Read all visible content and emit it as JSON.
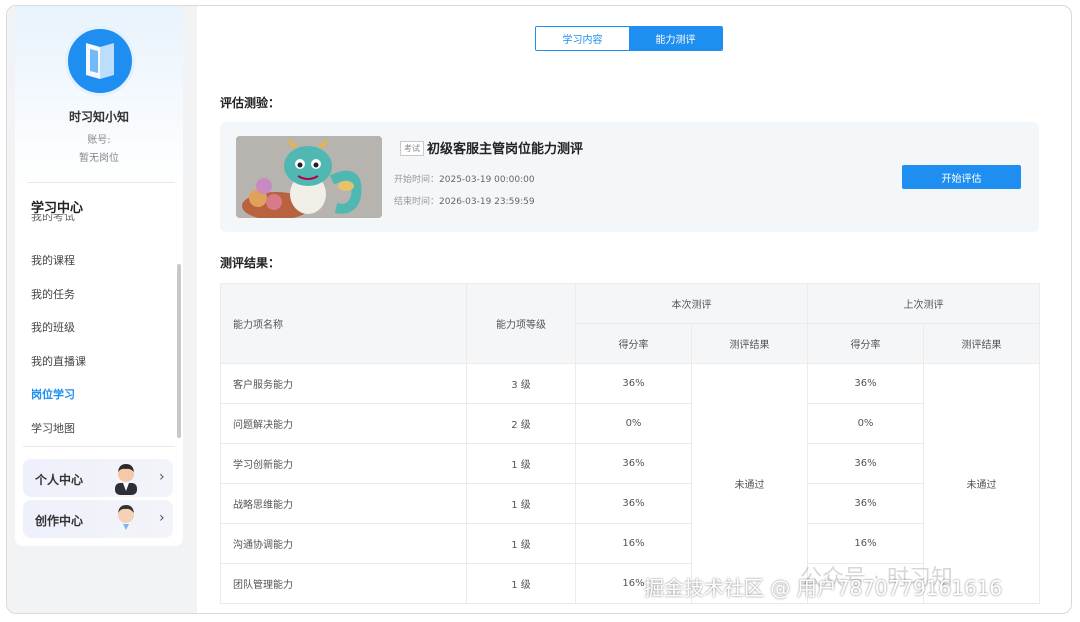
{
  "tabs": [
    {
      "label": "学习内容",
      "active": false
    },
    {
      "label": "能力测评",
      "active": true
    }
  ],
  "profile": {
    "username": "时习知小知",
    "account_label": "账号:",
    "position_label": "暂无岗位"
  },
  "menu": {
    "title": "学习中心",
    "clipped_item": "我的考试",
    "items": [
      {
        "label": "我的课程",
        "active": false
      },
      {
        "label": "我的任务",
        "active": false
      },
      {
        "label": "我的班级",
        "active": false
      },
      {
        "label": "我的直播课",
        "active": false
      },
      {
        "label": "岗位学习",
        "active": true
      },
      {
        "label": "学习地图",
        "active": false
      }
    ]
  },
  "centers": [
    {
      "label": "个人中心",
      "chevron": "›"
    },
    {
      "label": "创作中心",
      "chevron": "›"
    }
  ],
  "assessment": {
    "section_title": "评估测验：",
    "tag": "考试",
    "title": "初级客服主管岗位能力测评",
    "start_label": "开始时间：",
    "start_time": "2025-03-19 00:00:00",
    "end_label": "结束时间：",
    "end_time": "2026-03-19 23:59:59",
    "button": "开始评估"
  },
  "results": {
    "section_title": "测评结果：",
    "headers": {
      "name": "能力项名称",
      "level": "能力项等级",
      "current": "本次测评",
      "previous": "上次测评",
      "score_rate": "得分率",
      "result": "测评结果"
    },
    "current_result": "未通过",
    "previous_result": "未通过",
    "rows": [
      {
        "name": "客户服务能力",
        "level": "3 级",
        "current_rate": "36%",
        "previous_rate": "36%"
      },
      {
        "name": "问题解决能力",
        "level": "2 级",
        "current_rate": "0%",
        "previous_rate": "0%"
      },
      {
        "name": "学习创新能力",
        "level": "1 级",
        "current_rate": "36%",
        "previous_rate": "36%"
      },
      {
        "name": "战略思维能力",
        "level": "1 级",
        "current_rate": "36%",
        "previous_rate": "36%"
      },
      {
        "name": "沟通协调能力",
        "level": "1 级",
        "current_rate": "16%",
        "previous_rate": "16%"
      },
      {
        "name": "团队管理能力",
        "level": "1 级",
        "current_rate": "16%",
        "previous_rate": ""
      }
    ]
  },
  "watermark": "掘金技术社区 @ 用户787077916161​6",
  "wechat_watermark": "公众号 · 时习知",
  "colors": {
    "accent": "#1f8ef1"
  }
}
